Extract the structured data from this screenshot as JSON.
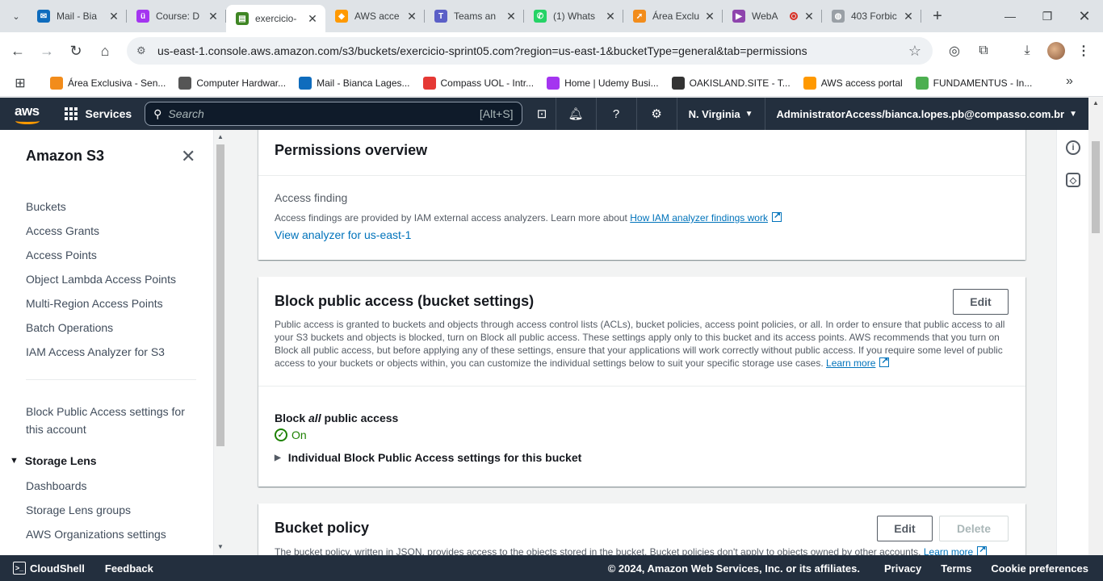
{
  "browser": {
    "tabs": [
      {
        "title": "Mail - Bia",
        "favicon_color": "#0f6cbd",
        "favicon_glyph": "✉"
      },
      {
        "title": "Course: D",
        "favicon_color": "#a435f0",
        "favicon_glyph": "ü"
      },
      {
        "title": "exercicio-",
        "favicon_color": "#3f8624",
        "favicon_glyph": "▤",
        "active": true
      },
      {
        "title": "AWS acce",
        "favicon_color": "#ff9900",
        "favicon_glyph": "◆"
      },
      {
        "title": "Teams an",
        "favicon_color": "#5b5fc7",
        "favicon_glyph": "T"
      },
      {
        "title": "(1) Whats",
        "favicon_color": "#25d366",
        "favicon_glyph": "✆"
      },
      {
        "title": "Área Exclu",
        "favicon_color": "#f28c1b",
        "favicon_glyph": "➚"
      },
      {
        "title": "WebA",
        "favicon_color": "#8e44ad",
        "favicon_glyph": "▶",
        "recording": true
      },
      {
        "title": "403 Forbic",
        "favicon_color": "#9aa0a6",
        "favicon_glyph": "◍"
      }
    ],
    "url": "us-east-1.console.aws.amazon.com/s3/buckets/exercicio-sprint05.com?region=us-east-1&bucketType=general&tab=permissions",
    "bookmarks": [
      {
        "label": "Área Exclusiva - Sen...",
        "color": "#f28c1b"
      },
      {
        "label": "Computer Hardwar...",
        "color": "#555555"
      },
      {
        "label": "Mail - Bianca Lages...",
        "color": "#0f6cbd"
      },
      {
        "label": "Compass UOL - Intr...",
        "color": "#e53935"
      },
      {
        "label": "Home | Udemy Busi...",
        "color": "#a435f0"
      },
      {
        "label": "OAKISLAND.SITE - T...",
        "color": "#333333"
      },
      {
        "label": "AWS access portal",
        "color": "#ff9900"
      },
      {
        "label": "FUNDAMENTUS - In...",
        "color": "#4caf50"
      }
    ]
  },
  "aws_nav": {
    "logo": "aws",
    "services": "Services",
    "search_placeholder": "Search",
    "search_shortcut": "[Alt+S]",
    "region": "N. Virginia",
    "account": "AdministratorAccess/bianca.lopes.pb@compasso.com.br"
  },
  "sidenav": {
    "title": "Amazon S3",
    "items": [
      "Buckets",
      "Access Grants",
      "Access Points",
      "Object Lambda Access Points",
      "Multi-Region Access Points",
      "Batch Operations",
      "IAM Access Analyzer for S3"
    ],
    "block_public_line1": "Block Public Access settings for",
    "block_public_line2": "this account",
    "section": "Storage Lens",
    "section_items": [
      "Dashboards",
      "Storage Lens groups",
      "AWS Organizations settings"
    ]
  },
  "permissions_overview": {
    "title": "Permissions overview",
    "access_finding_label": "Access finding",
    "access_finding_desc": "Access findings are provided by IAM external access analyzers. Learn more about",
    "access_finding_link": "How IAM analyzer findings work",
    "analyzer_link": "View analyzer for us-east-1"
  },
  "block_public_access": {
    "title": "Block public access (bucket settings)",
    "edit": "Edit",
    "description": "Public access is granted to buckets and objects through access control lists (ACLs), bucket policies, access point policies, or all. In order to ensure that public access to all your S3 buckets and objects is blocked, turn on Block all public access. These settings apply only to this bucket and its access points. AWS recommends that you turn on Block all public access, but before applying any of these settings, ensure that your applications will work correctly without public access. If you require some level of public access to your buckets or objects within, you can customize the individual settings below to suit your specific storage use cases.",
    "learn_more": "Learn more",
    "block_all_prefix": "Block",
    "block_all_em": "all",
    "block_all_suffix": "public access",
    "status": "On",
    "individual_settings": "Individual Block Public Access settings for this bucket"
  },
  "bucket_policy": {
    "title": "Bucket policy",
    "edit": "Edit",
    "delete": "Delete",
    "description": "The bucket policy, written in JSON, provides access to the objects stored in the bucket. Bucket policies don't apply to objects owned by other accounts.",
    "learn_more": "Learn more"
  },
  "footer": {
    "cloudshell": "CloudShell",
    "feedback": "Feedback",
    "copyright": "© 2024, Amazon Web Services, Inc. or its affiliates.",
    "privacy": "Privacy",
    "terms": "Terms",
    "cookies": "Cookie preferences"
  }
}
